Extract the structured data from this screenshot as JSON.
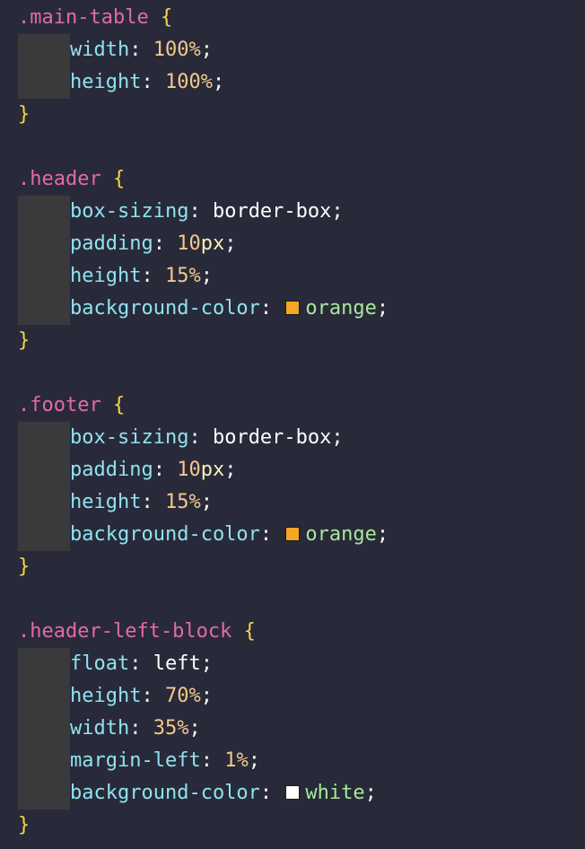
{
  "colors": {
    "background": "#282a3a",
    "selector": "#e36aa8",
    "brace": "#f5d547",
    "property": "#8fe3ef",
    "number": "#f5c88a",
    "keyword": "#ffffff",
    "color_name": "#a8e89b",
    "swatch_orange": "#f5a623",
    "swatch_white": "#ffffff"
  },
  "code": {
    "main_table": {
      "selector": ".main-table",
      "open": "{",
      "close": "}",
      "width_prop": "width",
      "width_num": "100",
      "width_unit": "%",
      "height_prop": "height",
      "height_num": "100",
      "height_unit": "%"
    },
    "header": {
      "selector": ".header",
      "open": "{",
      "close": "}",
      "box_prop": "box-sizing",
      "box_val": "border-box",
      "padding_prop": "padding",
      "padding_num": "10",
      "padding_unit": "px",
      "height_prop": "height",
      "height_num": "15",
      "height_unit": "%",
      "bg_prop": "background-color",
      "bg_val": "orange"
    },
    "footer": {
      "selector": ".footer",
      "open": "{",
      "close": "}",
      "box_prop": "box-sizing",
      "box_val": "border-box",
      "padding_prop": "padding",
      "padding_num": "10",
      "padding_unit": "px",
      "height_prop": "height",
      "height_num": "15",
      "height_unit": "%",
      "bg_prop": "background-color",
      "bg_val": "orange"
    },
    "header_left_block": {
      "selector": ".header-left-block",
      "open": "{",
      "close": "}",
      "float_prop": "float",
      "float_val": "left",
      "height_prop": "height",
      "height_num": "70",
      "height_unit": "%",
      "width_prop": "width",
      "width_num": "35",
      "width_unit": "%",
      "margin_prop": "margin-left",
      "margin_num": "1",
      "margin_unit": "%",
      "bg_prop": "background-color",
      "bg_val": "white"
    }
  }
}
